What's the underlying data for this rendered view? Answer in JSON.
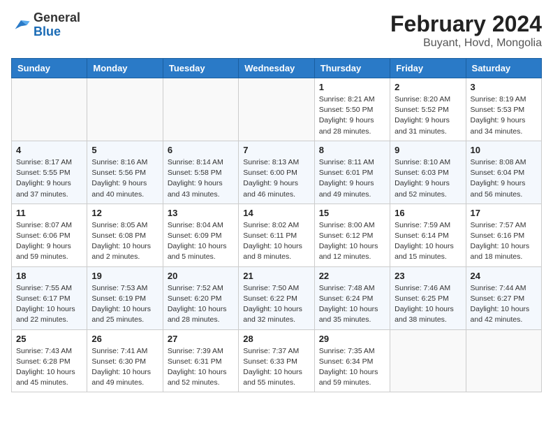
{
  "logo": {
    "general": "General",
    "blue": "Blue"
  },
  "title": "February 2024",
  "subtitle": "Buyant, Hovd, Mongolia",
  "days_of_week": [
    "Sunday",
    "Monday",
    "Tuesday",
    "Wednesday",
    "Thursday",
    "Friday",
    "Saturday"
  ],
  "weeks": [
    [
      {
        "day": "",
        "info": ""
      },
      {
        "day": "",
        "info": ""
      },
      {
        "day": "",
        "info": ""
      },
      {
        "day": "",
        "info": ""
      },
      {
        "day": "1",
        "info": "Sunrise: 8:21 AM\nSunset: 5:50 PM\nDaylight: 9 hours and 28 minutes."
      },
      {
        "day": "2",
        "info": "Sunrise: 8:20 AM\nSunset: 5:52 PM\nDaylight: 9 hours and 31 minutes."
      },
      {
        "day": "3",
        "info": "Sunrise: 8:19 AM\nSunset: 5:53 PM\nDaylight: 9 hours and 34 minutes."
      }
    ],
    [
      {
        "day": "4",
        "info": "Sunrise: 8:17 AM\nSunset: 5:55 PM\nDaylight: 9 hours and 37 minutes."
      },
      {
        "day": "5",
        "info": "Sunrise: 8:16 AM\nSunset: 5:56 PM\nDaylight: 9 hours and 40 minutes."
      },
      {
        "day": "6",
        "info": "Sunrise: 8:14 AM\nSunset: 5:58 PM\nDaylight: 9 hours and 43 minutes."
      },
      {
        "day": "7",
        "info": "Sunrise: 8:13 AM\nSunset: 6:00 PM\nDaylight: 9 hours and 46 minutes."
      },
      {
        "day": "8",
        "info": "Sunrise: 8:11 AM\nSunset: 6:01 PM\nDaylight: 9 hours and 49 minutes."
      },
      {
        "day": "9",
        "info": "Sunrise: 8:10 AM\nSunset: 6:03 PM\nDaylight: 9 hours and 52 minutes."
      },
      {
        "day": "10",
        "info": "Sunrise: 8:08 AM\nSunset: 6:04 PM\nDaylight: 9 hours and 56 minutes."
      }
    ],
    [
      {
        "day": "11",
        "info": "Sunrise: 8:07 AM\nSunset: 6:06 PM\nDaylight: 9 hours and 59 minutes."
      },
      {
        "day": "12",
        "info": "Sunrise: 8:05 AM\nSunset: 6:08 PM\nDaylight: 10 hours and 2 minutes."
      },
      {
        "day": "13",
        "info": "Sunrise: 8:04 AM\nSunset: 6:09 PM\nDaylight: 10 hours and 5 minutes."
      },
      {
        "day": "14",
        "info": "Sunrise: 8:02 AM\nSunset: 6:11 PM\nDaylight: 10 hours and 8 minutes."
      },
      {
        "day": "15",
        "info": "Sunrise: 8:00 AM\nSunset: 6:12 PM\nDaylight: 10 hours and 12 minutes."
      },
      {
        "day": "16",
        "info": "Sunrise: 7:59 AM\nSunset: 6:14 PM\nDaylight: 10 hours and 15 minutes."
      },
      {
        "day": "17",
        "info": "Sunrise: 7:57 AM\nSunset: 6:16 PM\nDaylight: 10 hours and 18 minutes."
      }
    ],
    [
      {
        "day": "18",
        "info": "Sunrise: 7:55 AM\nSunset: 6:17 PM\nDaylight: 10 hours and 22 minutes."
      },
      {
        "day": "19",
        "info": "Sunrise: 7:53 AM\nSunset: 6:19 PM\nDaylight: 10 hours and 25 minutes."
      },
      {
        "day": "20",
        "info": "Sunrise: 7:52 AM\nSunset: 6:20 PM\nDaylight: 10 hours and 28 minutes."
      },
      {
        "day": "21",
        "info": "Sunrise: 7:50 AM\nSunset: 6:22 PM\nDaylight: 10 hours and 32 minutes."
      },
      {
        "day": "22",
        "info": "Sunrise: 7:48 AM\nSunset: 6:24 PM\nDaylight: 10 hours and 35 minutes."
      },
      {
        "day": "23",
        "info": "Sunrise: 7:46 AM\nSunset: 6:25 PM\nDaylight: 10 hours and 38 minutes."
      },
      {
        "day": "24",
        "info": "Sunrise: 7:44 AM\nSunset: 6:27 PM\nDaylight: 10 hours and 42 minutes."
      }
    ],
    [
      {
        "day": "25",
        "info": "Sunrise: 7:43 AM\nSunset: 6:28 PM\nDaylight: 10 hours and 45 minutes."
      },
      {
        "day": "26",
        "info": "Sunrise: 7:41 AM\nSunset: 6:30 PM\nDaylight: 10 hours and 49 minutes."
      },
      {
        "day": "27",
        "info": "Sunrise: 7:39 AM\nSunset: 6:31 PM\nDaylight: 10 hours and 52 minutes."
      },
      {
        "day": "28",
        "info": "Sunrise: 7:37 AM\nSunset: 6:33 PM\nDaylight: 10 hours and 55 minutes."
      },
      {
        "day": "29",
        "info": "Sunrise: 7:35 AM\nSunset: 6:34 PM\nDaylight: 10 hours and 59 minutes."
      },
      {
        "day": "",
        "info": ""
      },
      {
        "day": "",
        "info": ""
      }
    ]
  ]
}
